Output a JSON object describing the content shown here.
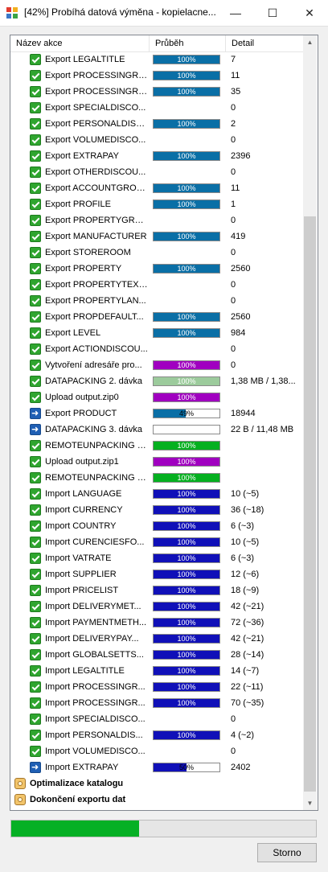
{
  "window": {
    "title": "[42%] Probíhá datová výměna - kopielacne...",
    "minimize_label": "—",
    "maximize_label": "☐",
    "close_label": "✕"
  },
  "columns": [
    "Název akce",
    "Průběh",
    "Detail"
  ],
  "colors": {
    "export": "#0a6fa6",
    "import": "#1010b8",
    "purple": "#a000c0",
    "green": "#05b020",
    "packing": "#9ccb9c"
  },
  "rows": [
    {
      "icon": "check",
      "name": "Export LEGALTITLE",
      "progress": 100,
      "progress_label": "100%",
      "bar_color": "export",
      "detail": "7"
    },
    {
      "icon": "check",
      "name": "Export PROCESSINGRE...",
      "progress": 100,
      "progress_label": "100%",
      "bar_color": "export",
      "detail": "11"
    },
    {
      "icon": "check",
      "name": "Export PROCESSINGRE...",
      "progress": 100,
      "progress_label": "100%",
      "bar_color": "export",
      "detail": "35"
    },
    {
      "icon": "check",
      "name": "Export SPECIALDISCO...",
      "progress": null,
      "progress_label": "",
      "bar_color": "",
      "detail": "0"
    },
    {
      "icon": "check",
      "name": "Export PERSONALDISC...",
      "progress": 100,
      "progress_label": "100%",
      "bar_color": "export",
      "detail": "2"
    },
    {
      "icon": "check",
      "name": "Export VOLUMEDISCO...",
      "progress": null,
      "progress_label": "",
      "bar_color": "",
      "detail": "0"
    },
    {
      "icon": "check",
      "name": "Export EXTRAPAY",
      "progress": 100,
      "progress_label": "100%",
      "bar_color": "export",
      "detail": "2396"
    },
    {
      "icon": "check",
      "name": "Export OTHERDISCOU...",
      "progress": null,
      "progress_label": "",
      "bar_color": "",
      "detail": "0"
    },
    {
      "icon": "check",
      "name": "Export ACCOUNTGROUP",
      "progress": 100,
      "progress_label": "100%",
      "bar_color": "export",
      "detail": "11"
    },
    {
      "icon": "check",
      "name": "Export PROFILE",
      "progress": 100,
      "progress_label": "100%",
      "bar_color": "export",
      "detail": "1"
    },
    {
      "icon": "check",
      "name": "Export PROPERTYGRO...",
      "progress": null,
      "progress_label": "",
      "bar_color": "",
      "detail": "0"
    },
    {
      "icon": "check",
      "name": "Export MANUFACTURER",
      "progress": 100,
      "progress_label": "100%",
      "bar_color": "export",
      "detail": "419"
    },
    {
      "icon": "check",
      "name": "Export STOREROOM",
      "progress": null,
      "progress_label": "",
      "bar_color": "",
      "detail": "0"
    },
    {
      "icon": "check",
      "name": "Export PROPERTY",
      "progress": 100,
      "progress_label": "100%",
      "bar_color": "export",
      "detail": "2560"
    },
    {
      "icon": "check",
      "name": "Export  PROPERTYTEXT...",
      "progress": null,
      "progress_label": "",
      "bar_color": "",
      "detail": "0"
    },
    {
      "icon": "check",
      "name": "Export PROPERTYLAN...",
      "progress": null,
      "progress_label": "",
      "bar_color": "",
      "detail": "0"
    },
    {
      "icon": "check",
      "name": "Export PROPDEFAULT...",
      "progress": 100,
      "progress_label": "100%",
      "bar_color": "export",
      "detail": "2560"
    },
    {
      "icon": "check",
      "name": "Export LEVEL",
      "progress": 100,
      "progress_label": "100%",
      "bar_color": "export",
      "detail": "984"
    },
    {
      "icon": "check",
      "name": "Export ACTIONDISCOU...",
      "progress": null,
      "progress_label": "",
      "bar_color": "",
      "detail": "0"
    },
    {
      "icon": "check",
      "name": "Vytvoření adresáře pro...",
      "progress": 100,
      "progress_label": "100%",
      "bar_color": "purple",
      "detail": "0"
    },
    {
      "icon": "check",
      "name": "DATAPACKING 2. dávka",
      "progress": 100,
      "progress_label": "100%",
      "bar_color": "packing",
      "detail": "1,38 MB / 1,38..."
    },
    {
      "icon": "check",
      "name": "Upload output.zip0",
      "progress": 100,
      "progress_label": "100%",
      "bar_color": "purple",
      "detail": ""
    },
    {
      "icon": "arrow",
      "name": "Export PRODUCT",
      "progress": 49,
      "progress_label": "49%",
      "bar_color": "export",
      "detail": "18944"
    },
    {
      "icon": "arrow",
      "name": "DATAPACKING 3. dávka",
      "progress": 0,
      "progress_label": "",
      "bar_color": "export",
      "detail": "22 B / 11,48 MB"
    },
    {
      "icon": "check",
      "name": "REMOTEUNPACKING o...",
      "progress": 100,
      "progress_label": "100%",
      "bar_color": "green",
      "detail": ""
    },
    {
      "icon": "check",
      "name": "Upload output.zip1",
      "progress": 100,
      "progress_label": "100%",
      "bar_color": "purple",
      "detail": ""
    },
    {
      "icon": "check",
      "name": "REMOTEUNPACKING o...",
      "progress": 100,
      "progress_label": "100%",
      "bar_color": "green",
      "detail": ""
    },
    {
      "icon": "check",
      "name": "Import LANGUAGE",
      "progress": 100,
      "progress_label": "100%",
      "bar_color": "import",
      "detail": "10 (~5)"
    },
    {
      "icon": "check",
      "name": "Import CURRENCY",
      "progress": 100,
      "progress_label": "100%",
      "bar_color": "import",
      "detail": "36 (~18)"
    },
    {
      "icon": "check",
      "name": "Import COUNTRY",
      "progress": 100,
      "progress_label": "100%",
      "bar_color": "import",
      "detail": "6 (~3)"
    },
    {
      "icon": "check",
      "name": "Import CURENCIESFO...",
      "progress": 100,
      "progress_label": "100%",
      "bar_color": "import",
      "detail": "10 (~5)"
    },
    {
      "icon": "check",
      "name": "Import VATRATE",
      "progress": 100,
      "progress_label": "100%",
      "bar_color": "import",
      "detail": "6 (~3)"
    },
    {
      "icon": "check",
      "name": "Import SUPPLIER",
      "progress": 100,
      "progress_label": "100%",
      "bar_color": "import",
      "detail": "12 (~6)"
    },
    {
      "icon": "check",
      "name": "Import PRICELIST",
      "progress": 100,
      "progress_label": "100%",
      "bar_color": "import",
      "detail": "18 (~9)"
    },
    {
      "icon": "check",
      "name": "Import DELIVERYMET...",
      "progress": 100,
      "progress_label": "100%",
      "bar_color": "import",
      "detail": "42 (~21)"
    },
    {
      "icon": "check",
      "name": "Import PAYMENTMETH...",
      "progress": 100,
      "progress_label": "100%",
      "bar_color": "import",
      "detail": "72 (~36)"
    },
    {
      "icon": "check",
      "name": "Import DELIVERYPAY...",
      "progress": 100,
      "progress_label": "100%",
      "bar_color": "import",
      "detail": "42 (~21)"
    },
    {
      "icon": "check",
      "name": "Import GLOBALSETTS...",
      "progress": 100,
      "progress_label": "100%",
      "bar_color": "import",
      "detail": "28 (~14)"
    },
    {
      "icon": "check",
      "name": "Import LEGALTITLE",
      "progress": 100,
      "progress_label": "100%",
      "bar_color": "import",
      "detail": "14 (~7)"
    },
    {
      "icon": "check",
      "name": "Import PROCESSINGR...",
      "progress": 100,
      "progress_label": "100%",
      "bar_color": "import",
      "detail": "22 (~11)"
    },
    {
      "icon": "check",
      "name": "Import PROCESSINGR...",
      "progress": 100,
      "progress_label": "100%",
      "bar_color": "import",
      "detail": "70 (~35)"
    },
    {
      "icon": "check",
      "name": "Import SPECIALDISCO...",
      "progress": null,
      "progress_label": "",
      "bar_color": "",
      "detail": "0"
    },
    {
      "icon": "check",
      "name": "Import PERSONALDIS...",
      "progress": 100,
      "progress_label": "100%",
      "bar_color": "import",
      "detail": "4 (~2)"
    },
    {
      "icon": "check",
      "name": "Import VOLUMEDISCO...",
      "progress": null,
      "progress_label": "",
      "bar_color": "",
      "detail": "0"
    },
    {
      "icon": "arrow",
      "name": "Import EXTRAPAY",
      "progress": 50,
      "progress_label": "50%",
      "bar_color": "import",
      "detail": "2402"
    },
    {
      "icon": "group",
      "name": "Optimalizace katalogu",
      "progress": null,
      "progress_label": "",
      "bar_color": "",
      "detail": ""
    },
    {
      "icon": "group",
      "name": "Dokončení exportu dat",
      "progress": null,
      "progress_label": "",
      "bar_color": "",
      "detail": ""
    }
  ],
  "overall_progress": 42,
  "cancel_label": "Storno"
}
